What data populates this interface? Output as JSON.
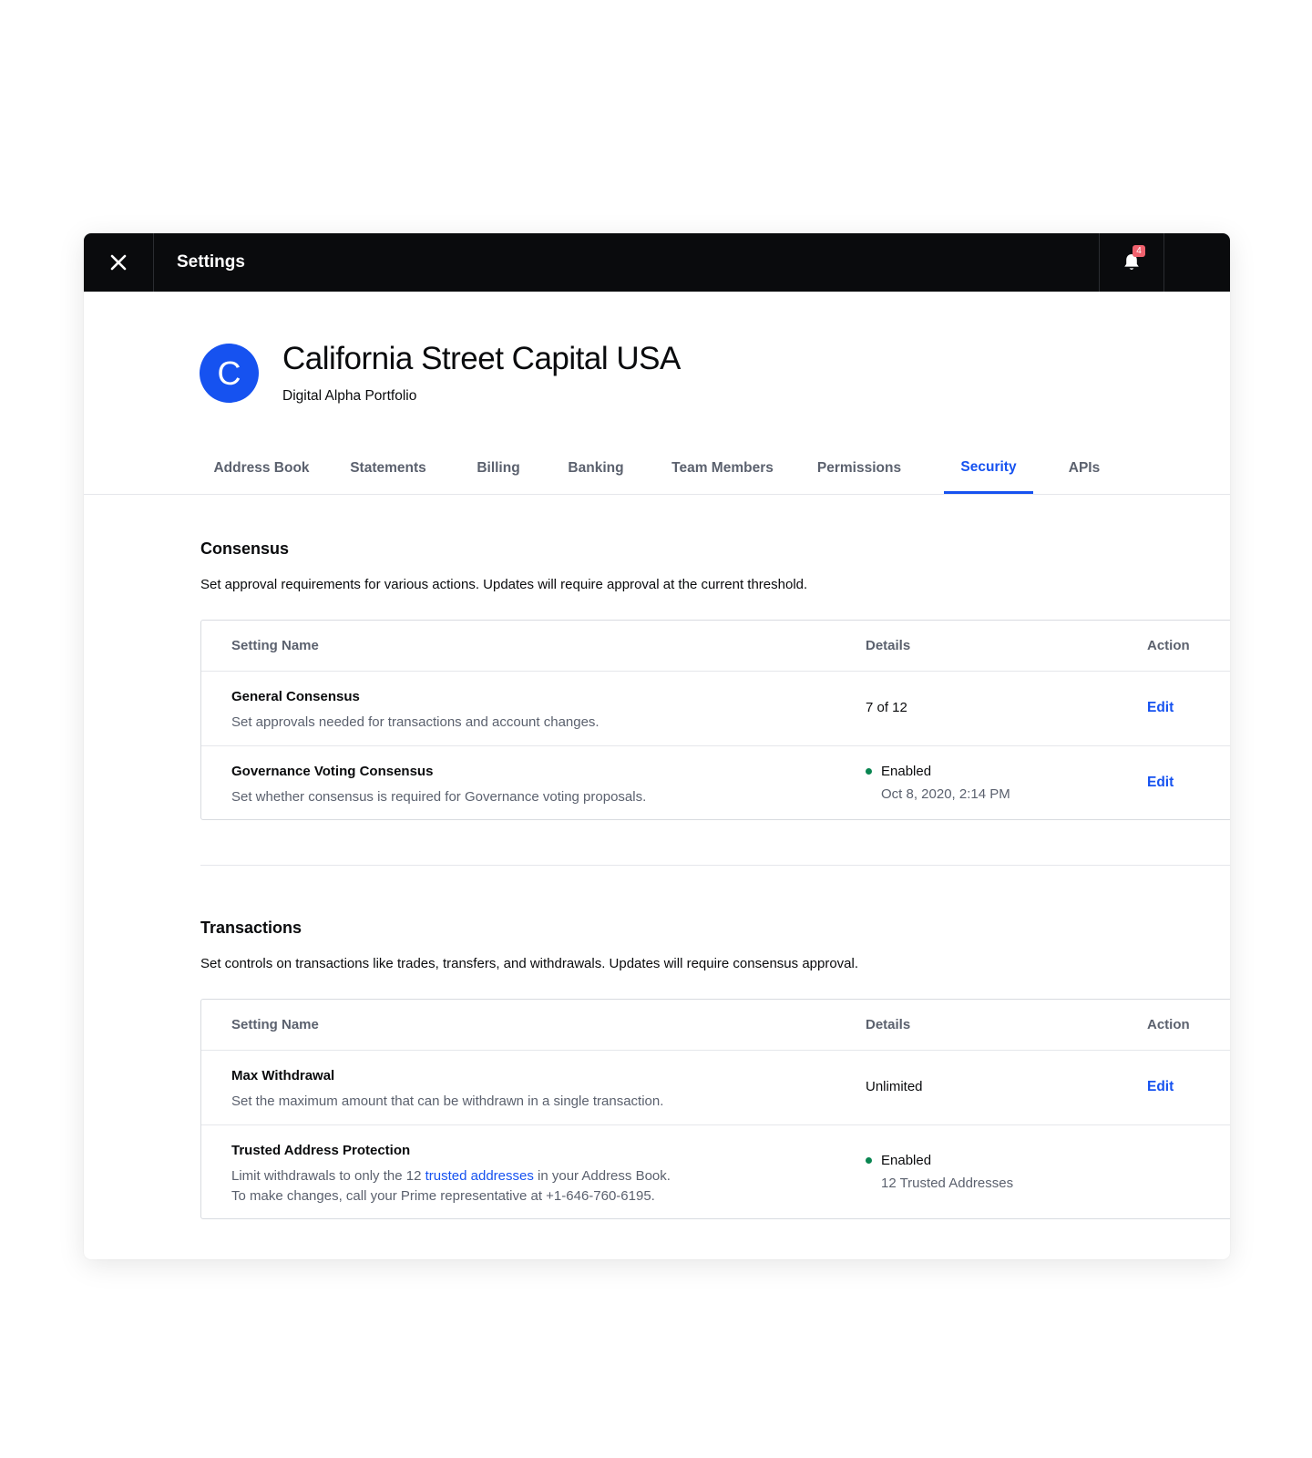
{
  "topbar": {
    "title": "Settings",
    "notification_count": "4"
  },
  "org": {
    "avatar_letter": "C",
    "name": "California Street Capital USA",
    "subtitle": "Digital Alpha Portfolio"
  },
  "tabs": [
    {
      "label": "Address Book"
    },
    {
      "label": "Statements"
    },
    {
      "label": "Billing"
    },
    {
      "label": "Banking"
    },
    {
      "label": "Team Members"
    },
    {
      "label": "Permissions"
    },
    {
      "label": "Security",
      "active": true
    },
    {
      "label": "APIs"
    }
  ],
  "consensus": {
    "title": "Consensus",
    "description": "Set approval requirements for various actions. Updates will require approval at the current threshold.",
    "headers": {
      "name": "Setting Name",
      "details": "Details",
      "action": "Action"
    },
    "rows": [
      {
        "title": "General Consensus",
        "description": "Set approvals needed for transactions and account changes.",
        "details": "7 of 12",
        "action": "Edit"
      },
      {
        "title": "Governance Voting Consensus",
        "description": "Set whether consensus is required for Governance voting proposals.",
        "status": "Enabled",
        "status_sub": "Oct 8, 2020, 2:14 PM",
        "action": "Edit"
      }
    ]
  },
  "transactions": {
    "title": "Transactions",
    "description": "Set controls on transactions like trades, transfers, and withdrawals. Updates will require consensus approval.",
    "headers": {
      "name": "Setting Name",
      "details": "Details",
      "action": "Action"
    },
    "rows": [
      {
        "title": "Max Withdrawal",
        "description": "Set the maximum amount that can be withdrawn in a single transaction.",
        "details": "Unlimited",
        "action": "Edit"
      },
      {
        "title": "Trusted Address Protection",
        "description_pre": "Limit withdrawals to only the 12 ",
        "description_link": "trusted addresses",
        "description_post": " in your Address Book.",
        "description_line2": "To make changes, call your Prime representative at +1-646-760-6195.",
        "status": "Enabled",
        "status_sub": "12 Trusted Addresses"
      }
    ]
  },
  "colors": {
    "accent": "#1652f0",
    "success": "#098551",
    "badge": "#f0616d",
    "topbar": "#0a0b0d"
  },
  "icons": {
    "close": "close-icon",
    "bell": "bell-icon"
  }
}
